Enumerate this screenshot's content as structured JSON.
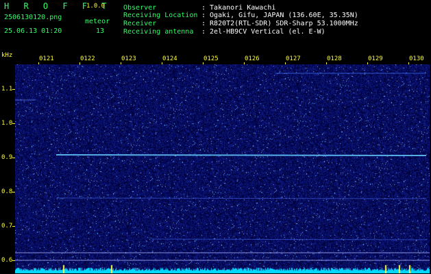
{
  "app": {
    "title": "H R O F F T",
    "version": "1.0.0",
    "filename": "2506130120.png",
    "datetime": "25.06.13 01:20",
    "mode_label": "meteor",
    "meteor_count": "13"
  },
  "info": {
    "labels": [
      "Observer",
      "Receiving Location",
      "Receiver",
      "Receiving antenna"
    ],
    "values": [
      ": Takanori Kawachi",
      ": Ogaki, Gifu, JAPAN (136.60E, 35.35N)",
      ": R820T2(RTL-SDR) SDR-Sharp 53.1000MHz",
      ": 2el-HB9CV Vertical (el. E-W)"
    ]
  },
  "axis": {
    "y_unit": "kHz",
    "y_ticks": [
      "1.1",
      "1.0",
      "0.9",
      "0.8",
      "0.7",
      "0.6"
    ],
    "y_values": [
      1.1,
      1.0,
      0.9,
      0.8,
      0.7,
      0.6
    ],
    "x_ticks": [
      "0121",
      "0122",
      "0123",
      "0124",
      "0125",
      "0126",
      "0127",
      "0128",
      "0129",
      "0130"
    ]
  },
  "colors": {
    "label": "#33ff66",
    "value": "#ffffff",
    "accent": "#ffff33",
    "waterfall_bg": "#000018",
    "signal": "#66ccff",
    "noise_floor": "#00e0ff"
  }
}
